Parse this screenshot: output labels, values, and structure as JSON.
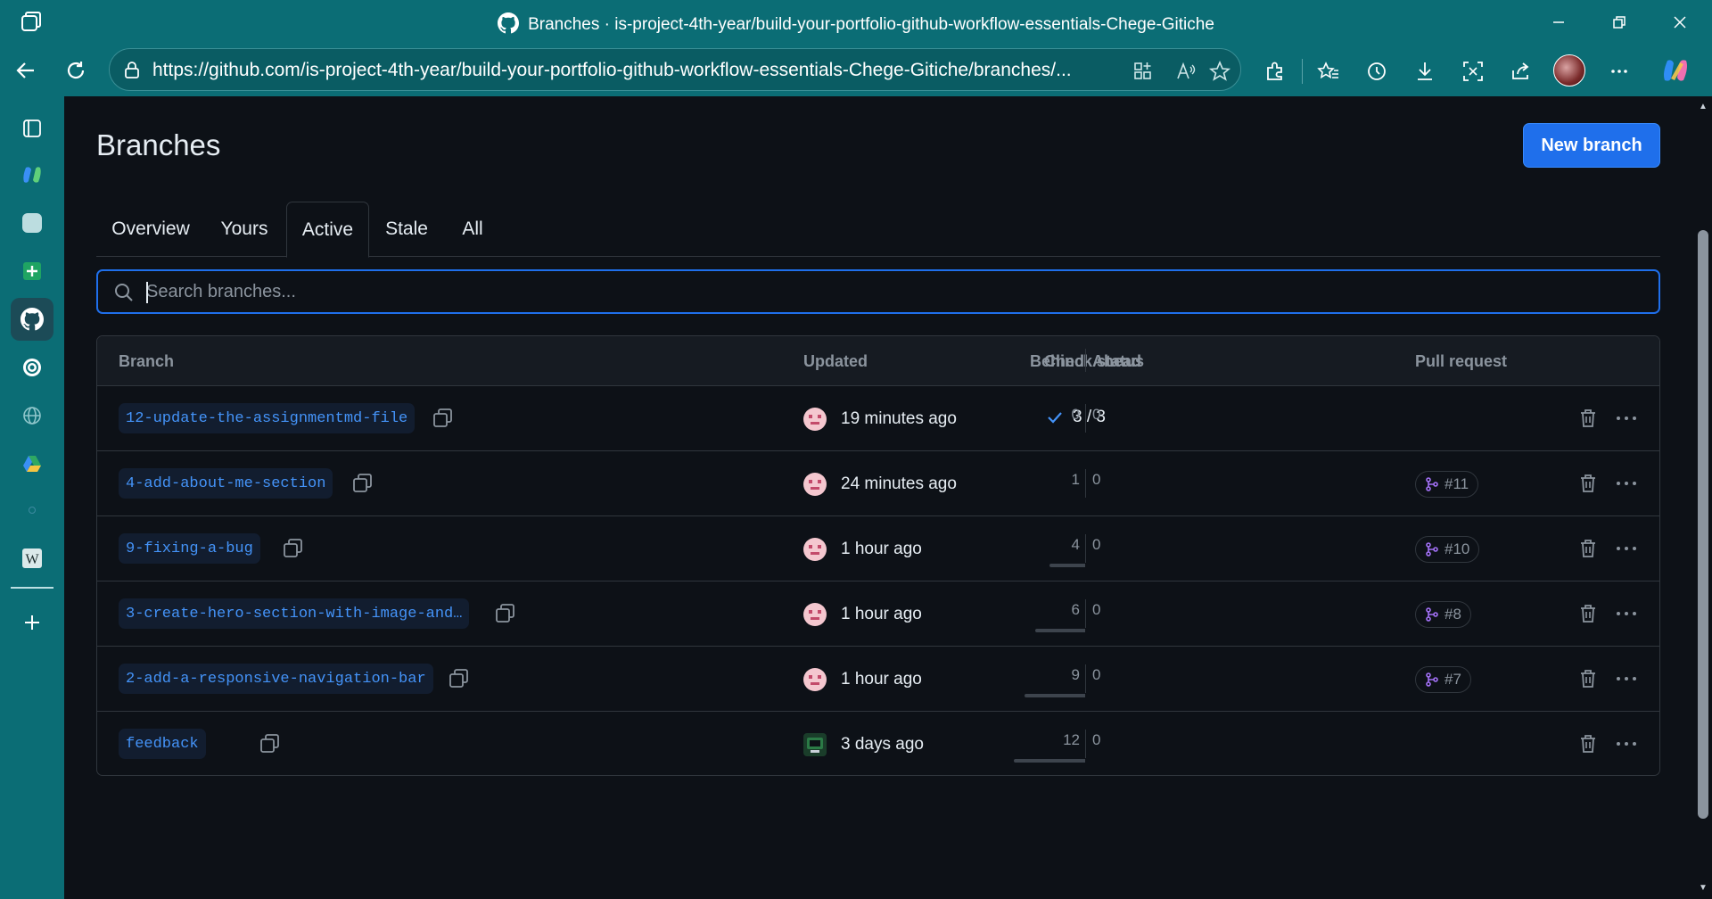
{
  "browser": {
    "title": "Branches · is-project-4th-year/build-your-portfolio-github-workflow-essentials-Chege-Gitiche",
    "url": "https://github.com/is-project-4th-year/build-your-portfolio-github-workflow-essentials-Chege-Gitiche/branches/..."
  },
  "page": {
    "title": "Branches",
    "new_branch_label": "New branch"
  },
  "tabs": [
    {
      "label": "Overview",
      "active": false
    },
    {
      "label": "Yours",
      "active": false
    },
    {
      "label": "Active",
      "active": true
    },
    {
      "label": "Stale",
      "active": false
    },
    {
      "label": "All",
      "active": false
    }
  ],
  "search": {
    "placeholder": "Search branches...",
    "value": ""
  },
  "table": {
    "headers": {
      "branch": "Branch",
      "updated": "Updated",
      "check_status": "Check status",
      "behind": "Behind",
      "ahead": "Ahead",
      "pull_request": "Pull request"
    },
    "rows": [
      {
        "name": "12-update-the-assignmentmd-file",
        "updated": "19 minutes ago",
        "check": "3 / 3",
        "behind": "0",
        "ahead": "0",
        "pr": ""
      },
      {
        "name": "4-add-about-me-section",
        "updated": "24 minutes ago",
        "check": "",
        "behind": "1",
        "ahead": "0",
        "pr": "#11"
      },
      {
        "name": "9-fixing-a-bug",
        "updated": "1 hour ago",
        "check": "",
        "behind": "4",
        "ahead": "0",
        "pr": "#10"
      },
      {
        "name": "3-create-hero-section-with-image-and…",
        "updated": "1 hour ago",
        "check": "",
        "behind": "6",
        "ahead": "0",
        "pr": "#8"
      },
      {
        "name": "2-add-a-responsive-navigation-bar",
        "updated": "1 hour ago",
        "check": "",
        "behind": "9",
        "ahead": "0",
        "pr": "#7"
      },
      {
        "name": "feedback",
        "updated": "3 days ago",
        "check": "",
        "behind": "12",
        "ahead": "0",
        "pr": ""
      }
    ]
  },
  "colors": {
    "accent": "#1f6feb",
    "link": "#4493f8",
    "chrome": "#0b6d75",
    "success": "#3fb950",
    "merged": "#a371f7"
  }
}
